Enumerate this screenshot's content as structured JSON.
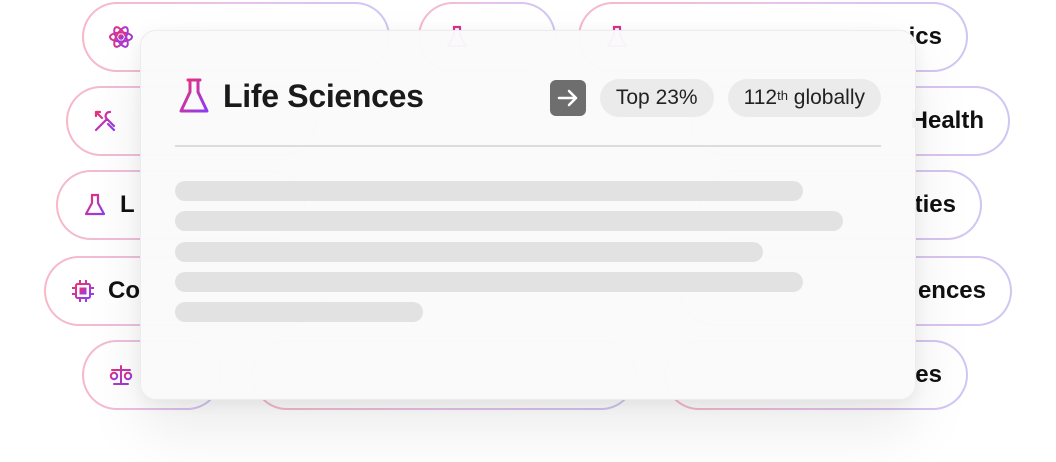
{
  "background_pills": [
    {
      "label": "",
      "icon": "atom-icon"
    },
    {
      "label": "",
      "icon": "flask-icon"
    },
    {
      "label": "ics",
      "icon": "flask-icon"
    },
    {
      "label": "",
      "icon": "tools-icon"
    },
    {
      "label": "Health",
      "icon": ""
    },
    {
      "label": "L",
      "icon": "flask-icon"
    },
    {
      "label": "ties",
      "icon": ""
    },
    {
      "label": "Co",
      "icon": "chip-icon"
    },
    {
      "label": "ences",
      "icon": ""
    },
    {
      "label": "",
      "icon": "scale-icon"
    },
    {
      "label": "es",
      "icon": ""
    }
  ],
  "card": {
    "title": "Life Sciences",
    "icon": "flask-icon",
    "go_icon": "arrow-right-icon",
    "rank_percent": "Top 23%",
    "global_rank_number": "112",
    "global_rank_suffix": "th",
    "global_rank_text": " globally"
  },
  "colors": {
    "accent_gradient_start": "#f0306e",
    "accent_gradient_end": "#8b3cf6",
    "pill_border_start": "#f8b8c8",
    "pill_border_end": "#cfc6f4",
    "button_gray": "#6e6e6e",
    "chip_bg": "#ebebeb"
  }
}
